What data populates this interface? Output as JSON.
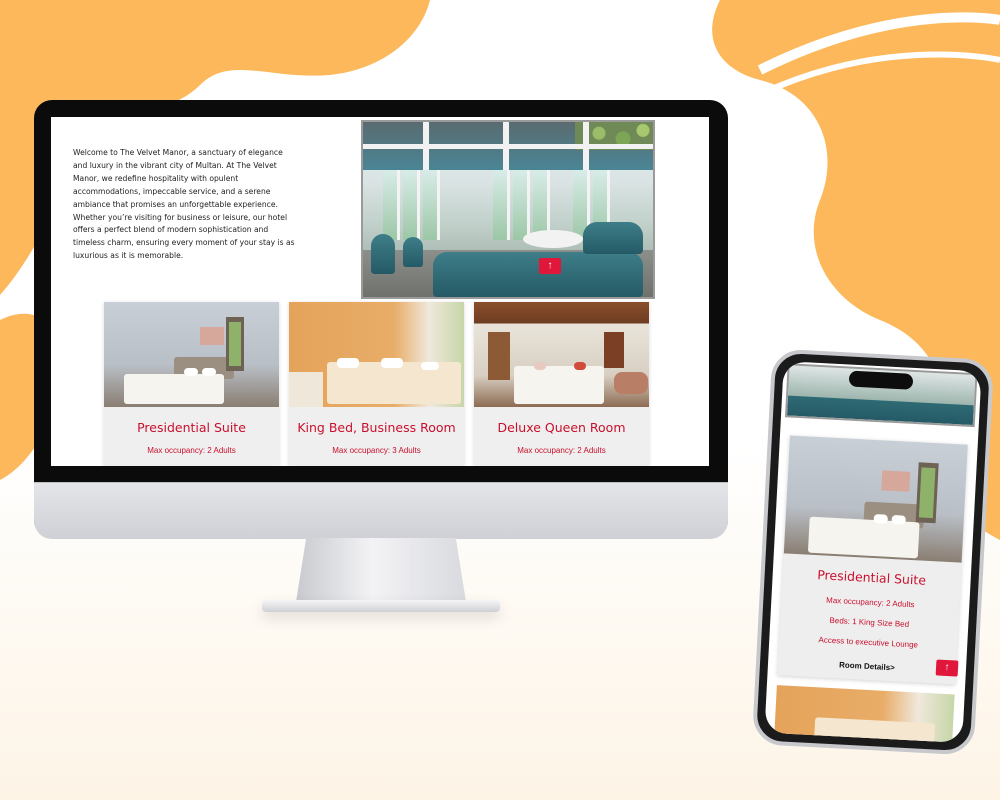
{
  "desktop": {
    "intro_text": "Welcome to The Velvet Manor, a sanctuary of elegance and luxury in the vibrant city of Multan. At The Velvet Manor, we redefine hospitality with opulent accommodations, impeccable service, and a serene ambiance that promises an unforgettable experience. Whether you’re visiting for business or leisure, our hotel offers a perfect blend of modern sophistication and timeless charm, ensuring every moment of your stay is as luxurious as it is memorable.",
    "scroll_top_icon": "↑",
    "rooms": [
      {
        "name": "Presidential Suite",
        "occupancy": "Max occupancy: 2 Adults"
      },
      {
        "name": "King Bed, Business Room",
        "occupancy": "Max occupancy: 3 Adults"
      },
      {
        "name": "Deluxe Queen Room",
        "occupancy": "Max occupancy: 2 Adults"
      }
    ]
  },
  "mobile": {
    "room": {
      "name": "Presidential Suite",
      "occupancy": "Max occupancy: 2 Adults",
      "beds": "Beds: 1 King Size Bed",
      "perk": "Access to executive Lounge",
      "details_link": "Room Details>"
    },
    "scroll_top_icon": "↑"
  },
  "colors": {
    "accent": "#c8102e",
    "button": "#e0163b",
    "background_shape": "#fcb85a"
  }
}
